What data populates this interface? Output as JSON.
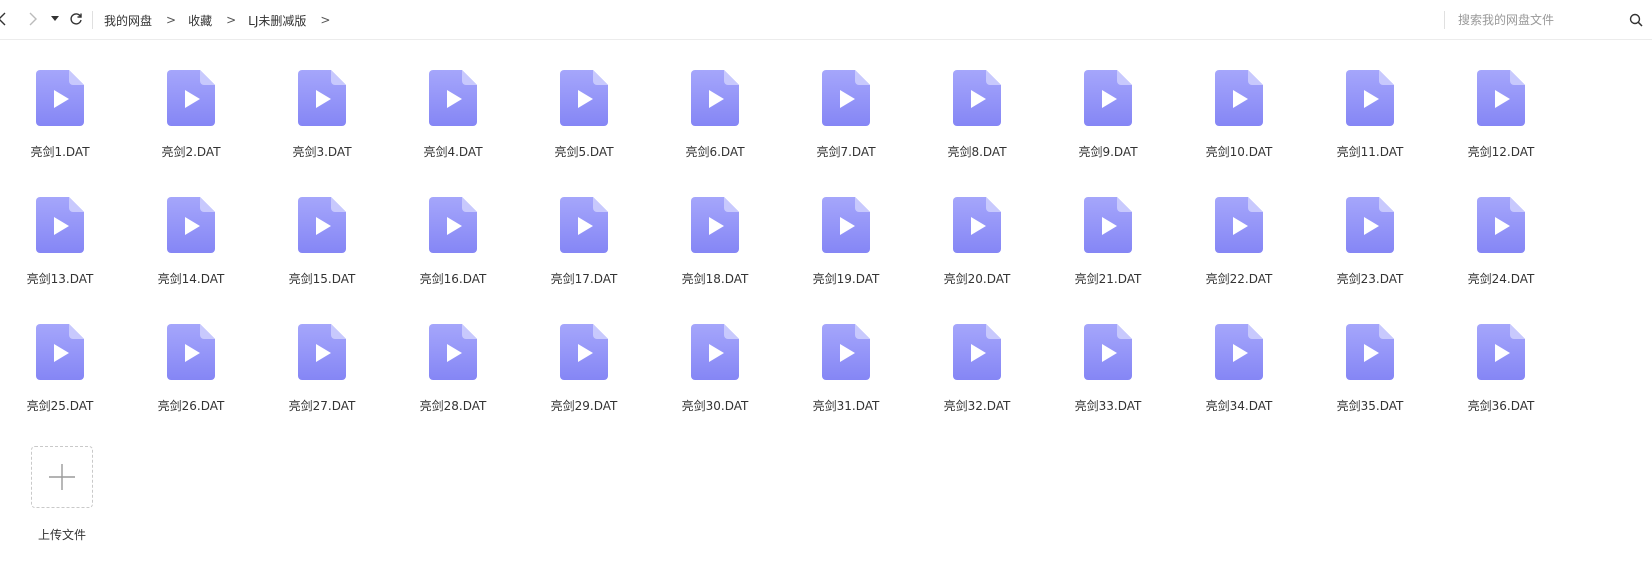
{
  "toolbar": {
    "back_icon": "chevron-left-icon",
    "forward_icon": "chevron-right-icon",
    "history_icon": "caret-down-icon",
    "refresh_icon": "refresh-icon",
    "breadcrumb": [
      {
        "label": "我的网盘"
      },
      {
        "label": "收藏"
      },
      {
        "label": "LJ未删减版"
      }
    ],
    "crumb_separator": ">",
    "search": {
      "placeholder": "搜索我的网盘文件",
      "value": "",
      "icon": "search-icon"
    }
  },
  "files": [
    {
      "name": "亮剑1.DAT"
    },
    {
      "name": "亮剑2.DAT"
    },
    {
      "name": "亮剑3.DAT"
    },
    {
      "name": "亮剑4.DAT"
    },
    {
      "name": "亮剑5.DAT"
    },
    {
      "name": "亮剑6.DAT"
    },
    {
      "name": "亮剑7.DAT"
    },
    {
      "name": "亮剑8.DAT"
    },
    {
      "name": "亮剑9.DAT"
    },
    {
      "name": "亮剑10.DAT"
    },
    {
      "name": "亮剑11.DAT"
    },
    {
      "name": "亮剑12.DAT"
    },
    {
      "name": "亮剑13.DAT"
    },
    {
      "name": "亮剑14.DAT"
    },
    {
      "name": "亮剑15.DAT"
    },
    {
      "name": "亮剑16.DAT"
    },
    {
      "name": "亮剑17.DAT"
    },
    {
      "name": "亮剑18.DAT"
    },
    {
      "name": "亮剑19.DAT"
    },
    {
      "name": "亮剑20.DAT"
    },
    {
      "name": "亮剑21.DAT"
    },
    {
      "name": "亮剑22.DAT"
    },
    {
      "name": "亮剑23.DAT"
    },
    {
      "name": "亮剑24.DAT"
    },
    {
      "name": "亮剑25.DAT"
    },
    {
      "name": "亮剑26.DAT"
    },
    {
      "name": "亮剑27.DAT"
    },
    {
      "name": "亮剑28.DAT"
    },
    {
      "name": "亮剑29.DAT"
    },
    {
      "name": "亮剑30.DAT"
    },
    {
      "name": "亮剑31.DAT"
    },
    {
      "name": "亮剑32.DAT"
    },
    {
      "name": "亮剑33.DAT"
    },
    {
      "name": "亮剑34.DAT"
    },
    {
      "name": "亮剑35.DAT"
    },
    {
      "name": "亮剑36.DAT"
    }
  ],
  "file_icon": "video-file-icon",
  "upload": {
    "label": "上传文件",
    "icon": "plus-icon"
  },
  "colors": {
    "icon_top": "#a5a6fb",
    "icon_bottom": "#8586f5",
    "icon_fold": "#c8c9fd"
  }
}
